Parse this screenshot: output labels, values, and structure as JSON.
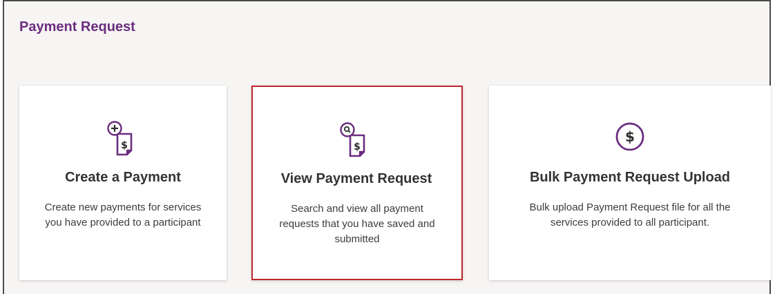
{
  "page": {
    "title": "Payment Request"
  },
  "colors": {
    "accent": "#6b2d7f",
    "selected_border": "#c0272d"
  },
  "cards": [
    {
      "icon": "document-plus-dollar-icon",
      "title": "Create a Payment",
      "description": "Create new payments for services you have provided to a participant",
      "selected": false
    },
    {
      "icon": "document-search-dollar-icon",
      "title": "View Payment Request",
      "description": "Search and view all payment requests that you have saved and submitted",
      "selected": true
    },
    {
      "icon": "dollar-circle-icon",
      "title": "Bulk Payment Request Upload",
      "description": "Bulk upload Payment Request file for all the services provided to all participant.",
      "selected": false
    }
  ]
}
